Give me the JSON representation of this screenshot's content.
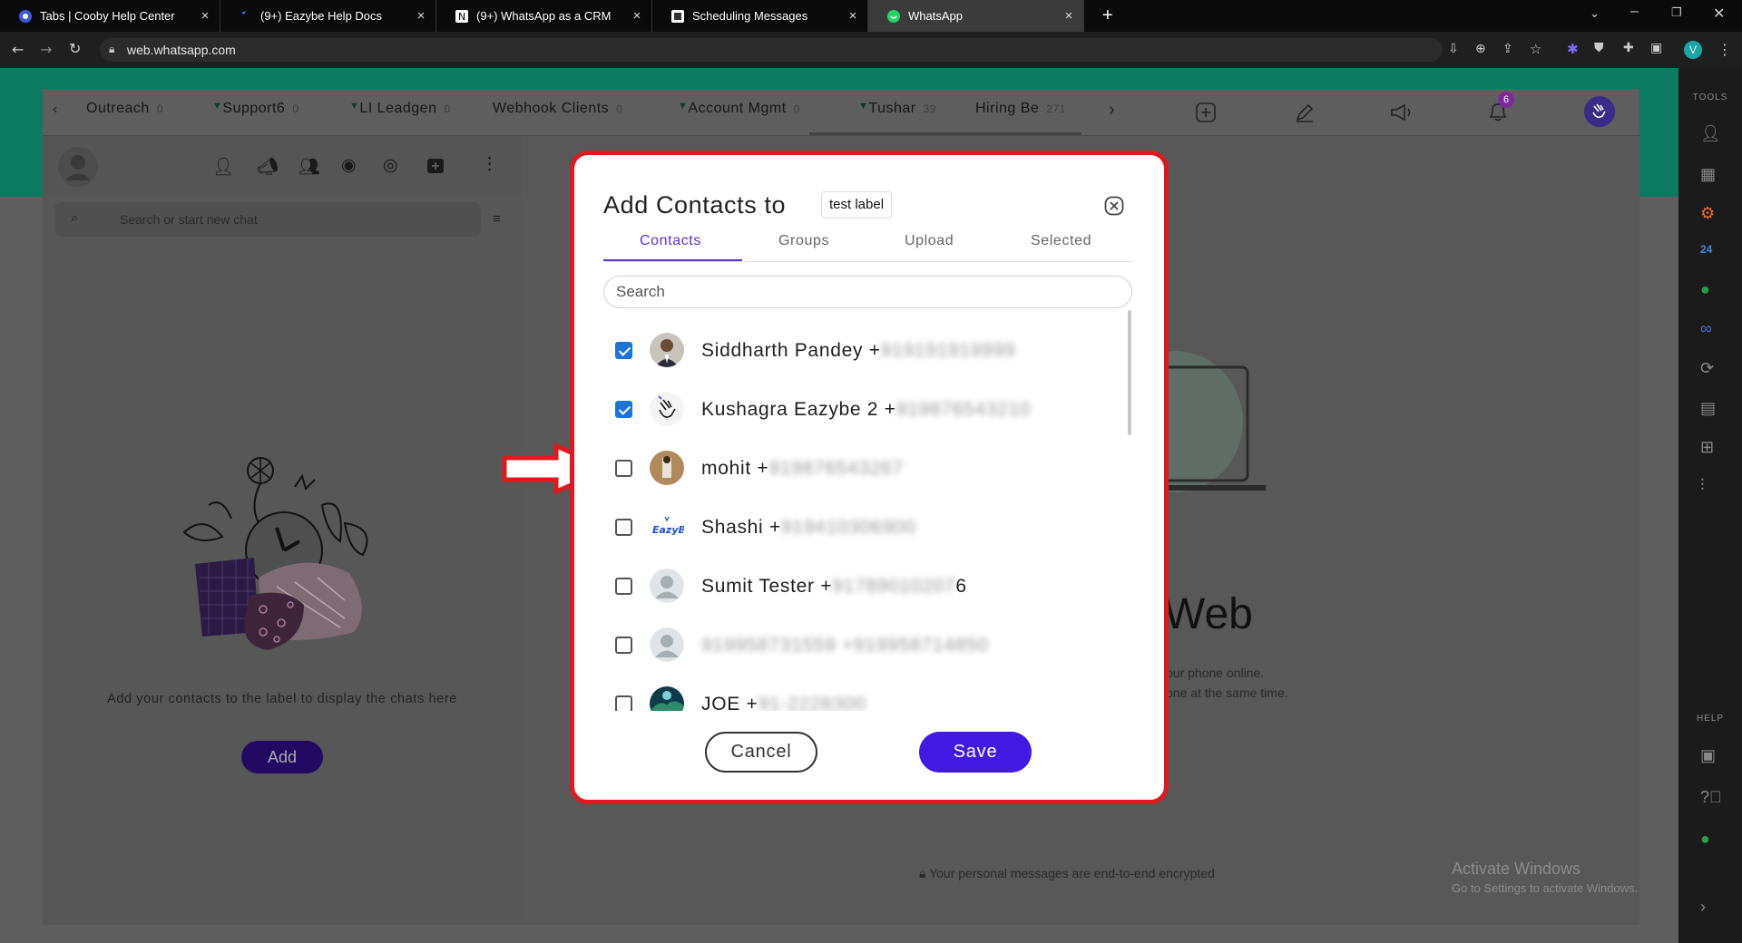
{
  "browser": {
    "tabs": [
      {
        "title": "Tabs | Cooby Help Center",
        "active": false
      },
      {
        "title": "(9+) Eazybe Help Docs",
        "active": false
      },
      {
        "title": "(9+) WhatsApp as a CRM",
        "active": false
      },
      {
        "title": "Scheduling Messages",
        "active": false
      },
      {
        "title": "WhatsApp",
        "active": true
      }
    ],
    "url": "web.whatsapp.com",
    "profile_initial": "V"
  },
  "labels_bar": {
    "items": [
      {
        "name": "Outreach",
        "count": "0"
      },
      {
        "name": "Support6",
        "count": "0"
      },
      {
        "name": "LI Leadgen",
        "count": "0"
      },
      {
        "name": "Webhook Clients",
        "count": "0"
      },
      {
        "name": "Account Mgmt",
        "count": "0"
      },
      {
        "name": "Tushar",
        "count": "39"
      },
      {
        "name": "Hiring Be",
        "count": "271"
      }
    ],
    "notification_count": "6"
  },
  "left_pane": {
    "search_placeholder": "Search or start new chat",
    "empty_message": "Add your contacts to the label to display the chats here",
    "add_button": "Add"
  },
  "right_pane": {
    "web_text": "Web",
    "line1": "our phone online.",
    "line2": "one at the same time.",
    "encrypted": "Your personal messages are end-to-end encrypted",
    "activate_title": "Activate Windows",
    "activate_sub": "Go to Settings to activate Windows."
  },
  "sidebar": {
    "tools_title": "TOOLS",
    "help_title": "HELP"
  },
  "modal": {
    "title": "Add Contacts to",
    "label_name": "test label",
    "tabs": [
      "Contacts",
      "Groups",
      "Upload",
      "Selected"
    ],
    "search_placeholder": "Search",
    "contacts": [
      {
        "name": "Siddharth Pandey +",
        "masked": "919191919999",
        "checked": true
      },
      {
        "name": "Kushagra Eazybe 2 +",
        "masked": "919876543210",
        "checked": true
      },
      {
        "name": "mohit +",
        "masked": "919876543267",
        "checked": false
      },
      {
        "name": "Shashi +",
        "masked": "919410306900",
        "checked": false
      },
      {
        "name": "Sumit Tester +",
        "masked": "91789010207",
        "suffix": "6",
        "checked": false
      },
      {
        "name": "",
        "masked": "919958731559 +919958714850",
        "checked": false
      },
      {
        "name": "JOE +",
        "masked": "91-2228300",
        "checked": false
      }
    ],
    "cancel": "Cancel",
    "save": "Save"
  },
  "colors": {
    "accent": "#4119e2",
    "highlight": "#e0191f",
    "checkbox": "#1e73d6",
    "whatsapp_green": "#0c7a60"
  }
}
